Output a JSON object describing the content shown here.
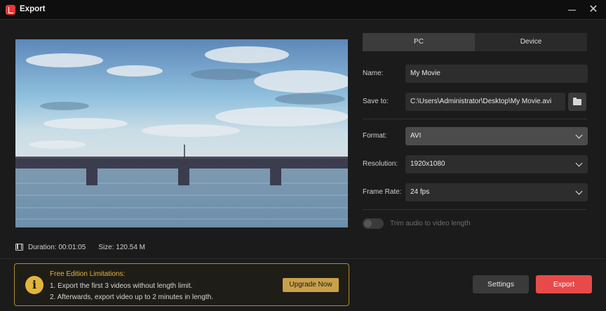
{
  "window": {
    "title": "Export"
  },
  "tabs": [
    {
      "label": "PC",
      "active": true
    },
    {
      "label": "Device",
      "active": false
    }
  ],
  "form": {
    "name_label": "Name:",
    "name_value": "My Movie",
    "save_to_label": "Save to:",
    "save_to_value": "C:\\Users\\Administrator\\Desktop\\My Movie.avi",
    "format_label": "Format:",
    "format_value": "AVI",
    "resolution_label": "Resolution:",
    "resolution_value": "1920x1080",
    "frame_rate_label": "Frame Rate:",
    "frame_rate_value": "24 fps",
    "trim_label": "Trim audio to video length",
    "trim_enabled": false
  },
  "preview": {
    "duration_text": "Duration:  00:01:05",
    "size_text": "Size:  120.54 M"
  },
  "limitations": {
    "title": "Free Edition Limitations:",
    "line1": "1. Export the first 3 videos without length limit.",
    "line2": "2. Afterwards, export video up to 2 minutes in length.",
    "upgrade_label": "Upgrade Now"
  },
  "footer": {
    "settings_label": "Settings",
    "export_label": "Export"
  },
  "icons": [
    "app-logo-icon",
    "minimize-icon",
    "close-icon",
    "folder-icon",
    "chevron-down-icon",
    "film-icon",
    "info-icon"
  ],
  "colors": {
    "accent_red": "#e84a4a",
    "warning_gold": "#e2b43a",
    "background": "#1b1b1b"
  }
}
